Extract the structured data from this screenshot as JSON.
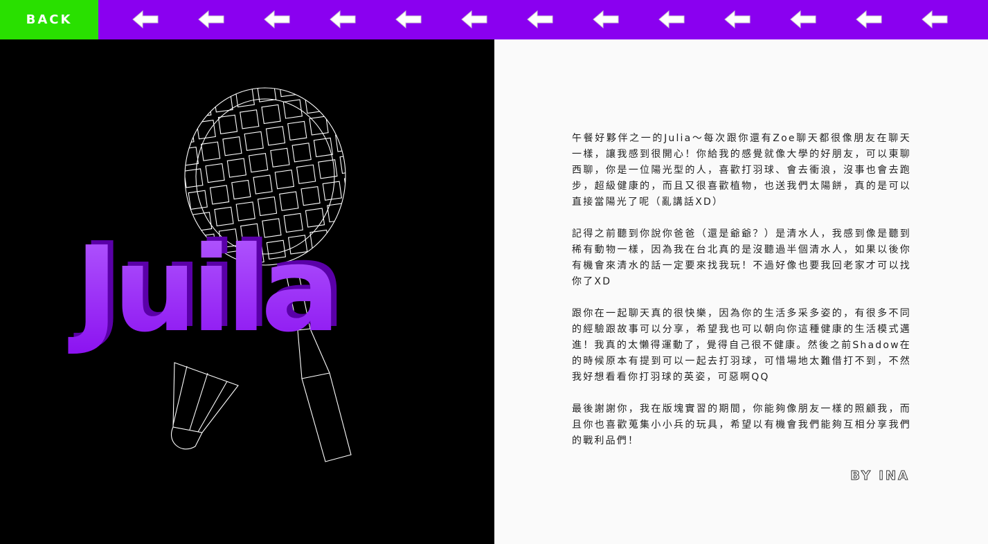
{
  "nav": {
    "back_label": "BACK",
    "arrow_icon": "left-arrow-icon",
    "arrow_count": 13,
    "colors": {
      "bar": "#8a00f0",
      "back": "#29e000",
      "arrow": "#ffffff"
    }
  },
  "hero": {
    "title": "Juila",
    "title_color": "#9b1fff",
    "icons": [
      "badminton-racket-icon",
      "shuttlecock-icon"
    ]
  },
  "letter": {
    "paragraphs": [
      "午餐好夥伴之一的Julia～每次跟你還有Zoe聊天都很像朋友在聊天一樣，讓我感到很開心！你給我的感覺就像大學的好朋友，可以東聊西聊，你是一位陽光型的人，喜歡打羽球、會去衝浪，沒事也會去跑步，超級健康的，而且又很喜歡植物，也送我們太陽餅，真的是可以直接當陽光了呢（亂講話XD）",
      "記得之前聽到你說你爸爸（還是爺爺？）是清水人，我感到像是聽到稀有動物一樣，因為我在台北真的是沒聽過半個清水人，如果以後你有機會來清水的話一定要來找我玩！不過好像也要我回老家才可以找你了XD",
      "跟你在一起聊天真的很快樂，因為你的生活多采多姿的，有很多不同的經驗跟故事可以分享，希望我也可以朝向你這種健康的生活模式邁進！我真的太懶得運動了，覺得自己很不健康。然後之前Shadow在的時候原本有提到可以一起去打羽球，可惜場地太難借打不到，不然我好想看看你打羽球的英姿，可惡啊QQ",
      "最後謝謝你，我在版塊實習的期間，你能夠像朋友一樣的照顧我，而且你也喜歡蒐集小小兵的玩具，希望以有機會我們能夠互相分享我們的戰利品們！"
    ],
    "signature": "BY INA"
  }
}
